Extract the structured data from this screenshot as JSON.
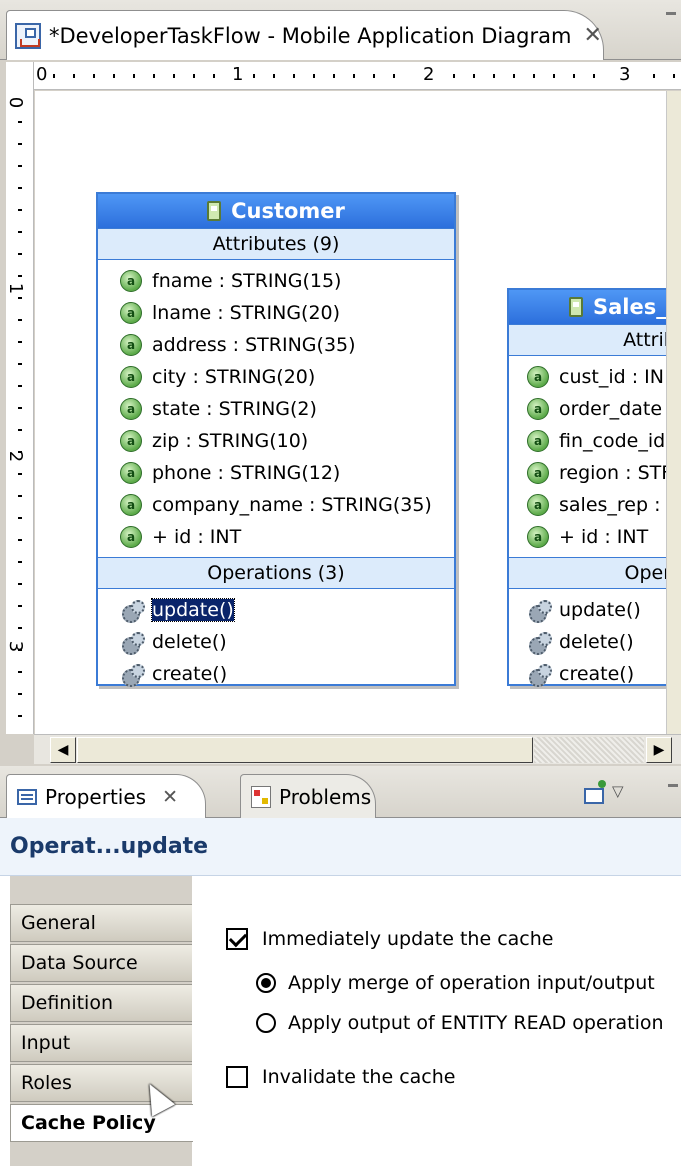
{
  "editor": {
    "tab_title": "*DeveloperTaskFlow - Mobile Application Diagram",
    "close_glyph": "✕"
  },
  "ruler": {
    "top_numbers": [
      "0",
      "1",
      "2",
      "3"
    ],
    "left_numbers": [
      "0",
      "1",
      "2",
      "3"
    ]
  },
  "diagram": {
    "customer": {
      "name": "Customer",
      "attributes_header": "Attributes (9)",
      "attributes": [
        "fname : STRING(15)",
        "lname : STRING(20)",
        "address : STRING(35)",
        "city : STRING(20)",
        "state : STRING(2)",
        "zip : STRING(10)",
        "phone : STRING(12)",
        "company_name : STRING(35)",
        "+ id : INT"
      ],
      "operations_header": "Operations (3)",
      "operations": [
        "update()",
        "delete()",
        "create()"
      ],
      "selected_operation": "update()"
    },
    "sales": {
      "name": "Sales_",
      "attributes_header": "Attribute",
      "attributes": [
        "cust_id : IN",
        "order_date",
        "fin_code_id",
        "region : STF",
        "sales_rep :",
        "+ id : INT"
      ],
      "operations_header": "Operatio",
      "operations": [
        "update()",
        "delete()",
        "create()"
      ]
    }
  },
  "scrollbar": {
    "left_arrow": "◀",
    "right_arrow": "▶"
  },
  "views": {
    "properties_tab": "Properties",
    "problems_tab": "Problems",
    "close_glyph": "✕",
    "menu_glyph": "▽"
  },
  "properties": {
    "title": "Operat...update",
    "side_tabs": [
      "General",
      "Data Source",
      "Definition",
      "Input",
      "Roles",
      "Cache Policy"
    ],
    "active_tab": "Cache Policy",
    "options": {
      "immediate_update": {
        "label": "Immediately update the cache",
        "checked": true
      },
      "apply_merge": {
        "label": "Apply merge of operation input/output",
        "selected": true
      },
      "apply_entity_read": {
        "label": "Apply output of ENTITY READ operation",
        "selected": false
      },
      "invalidate": {
        "label": "Invalidate the cache",
        "checked": false
      }
    }
  },
  "colors": {
    "entity_header": "#2c6fdc",
    "compartment": "#dcebfb",
    "selection": "#0a246a",
    "title_text": "#1a3a6a"
  }
}
